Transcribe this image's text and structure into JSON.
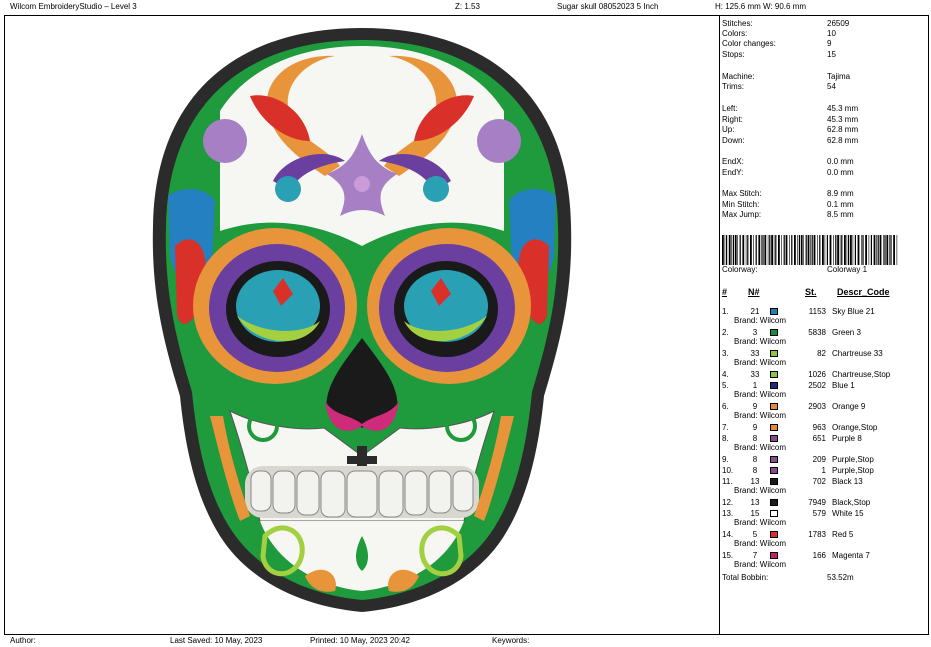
{
  "header": {
    "app_title": "Wilcom EmbroideryStudio – Level 3",
    "zoom": "Z: 1.53",
    "design_name": "Sugar skull 08052023 5 Inch",
    "dimensions": "H: 125.6 mm   W: 90.6 mm"
  },
  "stats": [
    {
      "label": "Stitches:",
      "value": "26509"
    },
    {
      "label": "Colors:",
      "value": "10"
    },
    {
      "label": "Color changes:",
      "value": "9"
    },
    {
      "label": "Stops:",
      "value": "15"
    },
    {
      "label": "Machine:",
      "value": "Tajima"
    },
    {
      "label": "Trims:",
      "value": "54"
    },
    {
      "label": "Left:",
      "value": "45.3 mm"
    },
    {
      "label": "Right:",
      "value": "45.3 mm"
    },
    {
      "label": "Up:",
      "value": "62.8 mm"
    },
    {
      "label": "Down:",
      "value": "62.8 mm"
    },
    {
      "label": "EndX:",
      "value": "0.0 mm"
    },
    {
      "label": "EndY:",
      "value": "0.0 mm"
    },
    {
      "label": "Max Stitch:",
      "value": "8.9 mm"
    },
    {
      "label": "Min Stitch:",
      "value": "0.1 mm"
    },
    {
      "label": "Max Jump:",
      "value": "8.5 mm"
    }
  ],
  "colorway": {
    "label": "Colorway:",
    "value": "Colorway 1"
  },
  "table_headers": {
    "hash": "#",
    "n": "N#",
    "st": "St.",
    "descr": "Descr_Code"
  },
  "colors": [
    {
      "num": "1.",
      "n": "21",
      "hex": "#1f7fb0",
      "st": "1153",
      "descr": "Sky Blue 21",
      "brand": "Brand: Wilcom"
    },
    {
      "num": "2.",
      "n": "3",
      "hex": "#1a8a3a",
      "st": "5838",
      "descr": "Green 3",
      "brand": "Brand: Wilcom"
    },
    {
      "num": "3.",
      "n": "33",
      "hex": "#8cc63e",
      "st": "82",
      "descr": "Chartreuse 33",
      "brand": "Brand: Wilcom"
    },
    {
      "num": "4.",
      "n": "33",
      "hex": "#8cc63e",
      "st": "1026",
      "descr": "Chartreuse,Stop",
      "brand": ""
    },
    {
      "num": "5.",
      "n": "1",
      "hex": "#1d2a7a",
      "st": "2502",
      "descr": "Blue 1",
      "brand": "Brand: Wilcom"
    },
    {
      "num": "6.",
      "n": "9",
      "hex": "#e8893a",
      "st": "2903",
      "descr": "Orange 9",
      "brand": "Brand: Wilcom"
    },
    {
      "num": "7.",
      "n": "9",
      "hex": "#e8893a",
      "st": "963",
      "descr": "Orange,Stop",
      "brand": ""
    },
    {
      "num": "8.",
      "n": "8",
      "hex": "#8b4a8c",
      "st": "651",
      "descr": "Purple 8",
      "brand": "Brand: Wilcom"
    },
    {
      "num": "9.",
      "n": "8",
      "hex": "#8b4a8c",
      "st": "209",
      "descr": "Purple,Stop",
      "brand": ""
    },
    {
      "num": "10.",
      "n": "8",
      "hex": "#8b4a8c",
      "st": "1",
      "descr": "Purple,Stop",
      "brand": ""
    },
    {
      "num": "11.",
      "n": "13",
      "hex": "#1a1a1a",
      "st": "702",
      "descr": "Black 13",
      "brand": "Brand: Wilcom"
    },
    {
      "num": "12.",
      "n": "13",
      "hex": "#1a1a1a",
      "st": "7949",
      "descr": "Black,Stop",
      "brand": ""
    },
    {
      "num": "13.",
      "n": "15",
      "hex": "#ffffff",
      "st": "579",
      "descr": "White 15",
      "brand": "Brand: Wilcom"
    },
    {
      "num": "14.",
      "n": "5",
      "hex": "#d9302a",
      "st": "1783",
      "descr": "Red 5",
      "brand": "Brand: Wilcom"
    },
    {
      "num": "15.",
      "n": "7",
      "hex": "#c41f6e",
      "st": "166",
      "descr": "Magenta 7",
      "brand": "Brand: Wilcom"
    }
  ],
  "total_bobbin": {
    "label": "Total Bobbin:",
    "value": "53.52m"
  },
  "footer": {
    "author": "Author:",
    "last_saved": "Last Saved: 10 May, 2023",
    "printed": "Printed: 10 May, 2023 20:42",
    "keywords": "Keywords:"
  },
  "palette": {
    "outline": "#2b2b2b",
    "green": "#1f9a3c",
    "orange": "#e8943a",
    "purple": "#6a3fa0",
    "lilac": "#a77fc4",
    "red": "#d9302a",
    "blue": "#2480c0",
    "teal": "#2aa0b5",
    "chartreuse": "#a2d040",
    "magenta": "#d02a7a",
    "white": "#f6f6f2",
    "black": "#1a1a1a"
  }
}
